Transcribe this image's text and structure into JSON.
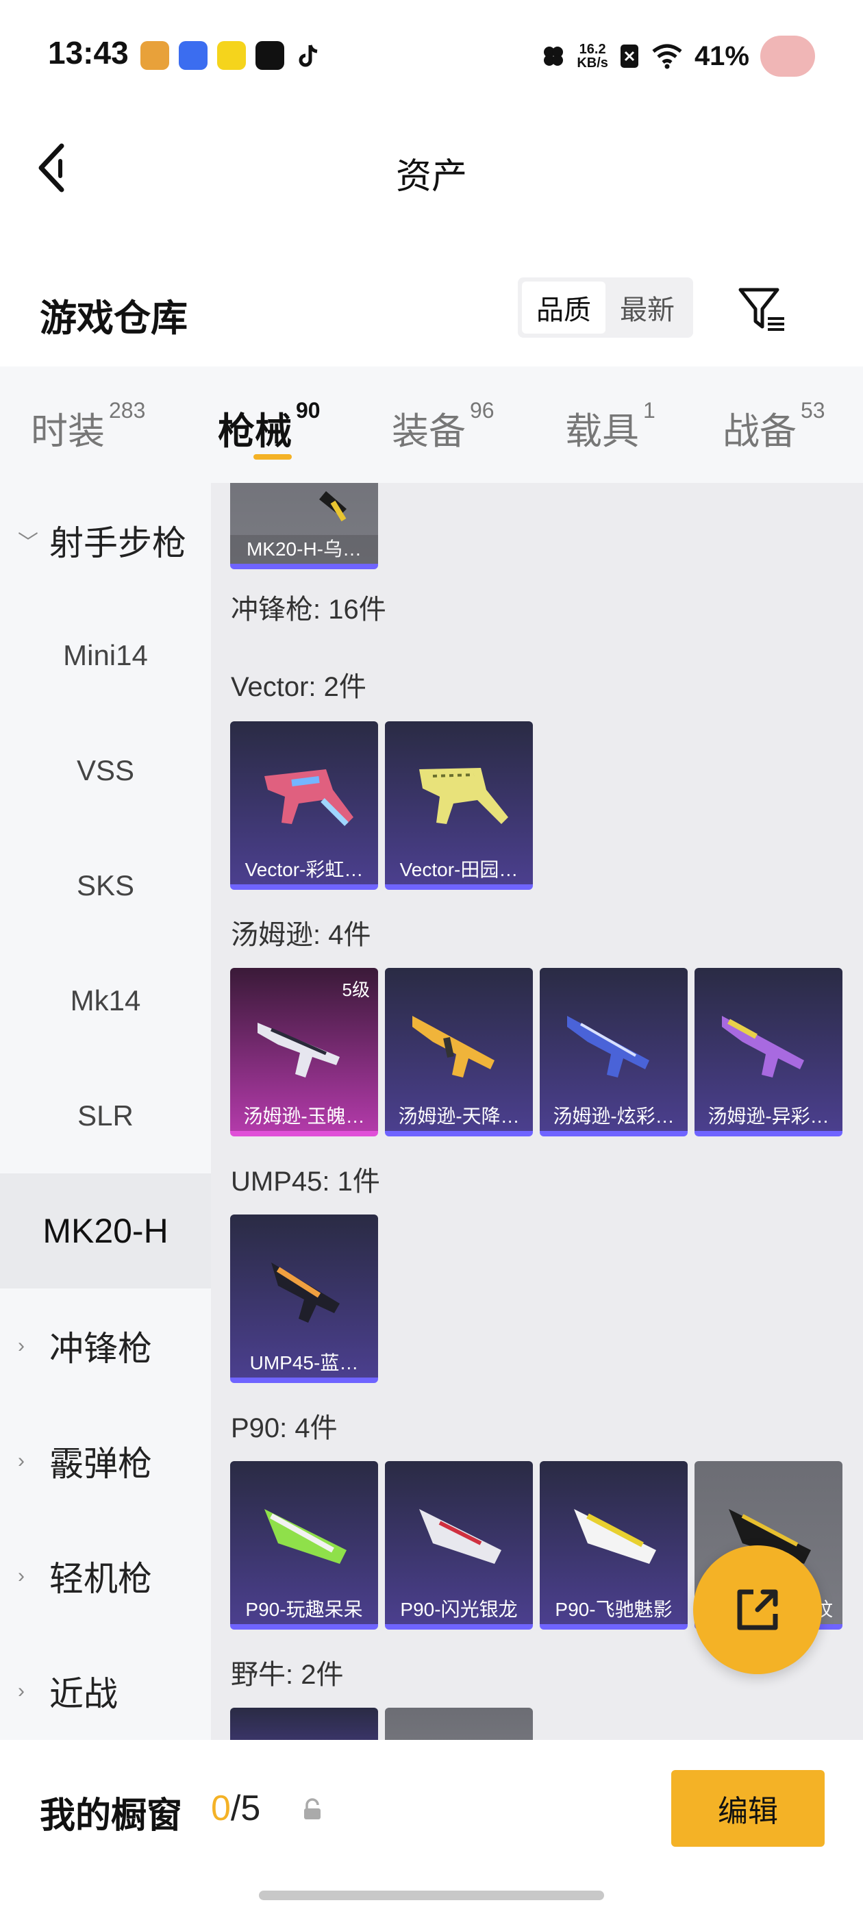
{
  "status_bar": {
    "time": "13:43",
    "net_speed": "16.2",
    "net_unit": "KB/s",
    "battery": "41%",
    "icons": [
      "app-icon-1",
      "app-icon-2",
      "app-icon-3",
      "app-icon-4",
      "tiktok-icon",
      "nfc-icon",
      "sim-icon",
      "wifi-icon",
      "avatar-icon"
    ]
  },
  "header": {
    "title": "资产"
  },
  "section": {
    "title": "游戏仓库",
    "sort_options": [
      "品质",
      "最新"
    ],
    "sort_selected": "品质"
  },
  "tabs": [
    {
      "label": "时装",
      "count": "283"
    },
    {
      "label": "枪械",
      "count": "90",
      "active": true
    },
    {
      "label": "装备",
      "count": "96"
    },
    {
      "label": "载具",
      "count": "1"
    },
    {
      "label": "战备",
      "count": "53"
    }
  ],
  "sidebar": {
    "items": [
      {
        "label": "射手步枪",
        "type": "group",
        "expanded": true
      },
      {
        "label": "Mini14",
        "type": "item"
      },
      {
        "label": "VSS",
        "type": "item"
      },
      {
        "label": "SKS",
        "type": "item"
      },
      {
        "label": "Mk14",
        "type": "item"
      },
      {
        "label": "SLR",
        "type": "item"
      },
      {
        "label": "MK20-H",
        "type": "item",
        "active": true
      },
      {
        "label": "冲锋枪",
        "type": "group"
      },
      {
        "label": "霰弹枪",
        "type": "group"
      },
      {
        "label": "轻机枪",
        "type": "group"
      },
      {
        "label": "近战",
        "type": "group"
      }
    ]
  },
  "content": {
    "top_card": {
      "label": "MK20-H-乌…"
    },
    "category_header": "冲锋枪: 16件",
    "sections": [
      {
        "title": "Vector: 2件",
        "items": [
          {
            "label": "Vector-彩虹…"
          },
          {
            "label": "Vector-田园…"
          }
        ]
      },
      {
        "title": "汤姆逊: 4件",
        "items": [
          {
            "label": "汤姆逊-玉魄…",
            "level": "5级"
          },
          {
            "label": "汤姆逊-天降…"
          },
          {
            "label": "汤姆逊-炫彩…"
          },
          {
            "label": "汤姆逊-异彩…"
          }
        ]
      },
      {
        "title": "UMP45: 1件",
        "items": [
          {
            "label": "UMP45-蓝…"
          }
        ]
      },
      {
        "title": "P90: 4件",
        "items": [
          {
            "label": "P90-玩趣呆呆"
          },
          {
            "label": "P90-闪光银龙"
          },
          {
            "label": "P90-飞驰魅影"
          },
          {
            "label": "纹"
          }
        ]
      },
      {
        "title": "野牛: 2件",
        "items": []
      }
    ]
  },
  "bottom_bar": {
    "label": "我的橱窗",
    "count_current": "0",
    "count_total": "/5",
    "edit_label": "编辑"
  },
  "colors": {
    "accent": "#f4b226",
    "card_purple": "#4b3f8e",
    "card_pink": "#b23aa9",
    "card_gray": "#7a7b82"
  }
}
